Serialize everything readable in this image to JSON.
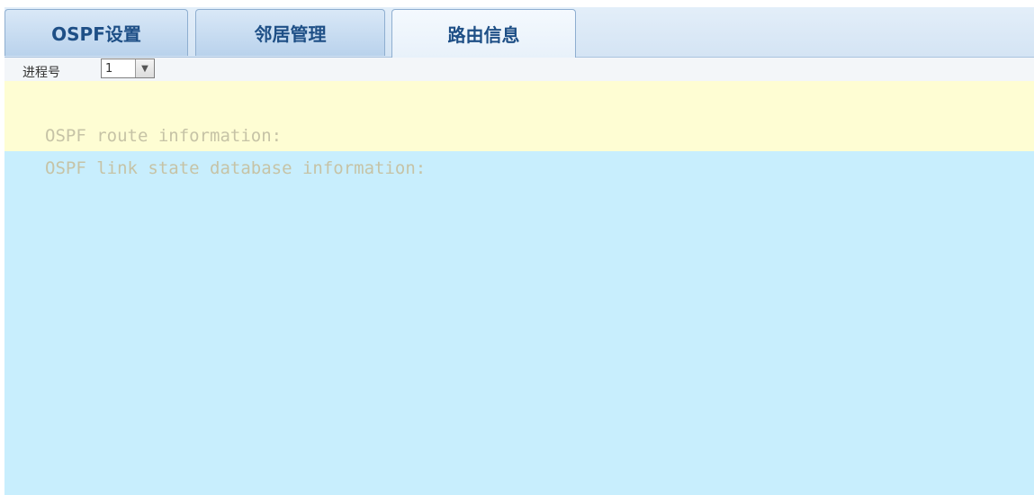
{
  "tabs": [
    {
      "label": "OSPF设置",
      "active": false
    },
    {
      "label": "邻居管理",
      "active": false
    },
    {
      "label": "路由信息",
      "active": true
    }
  ],
  "toolbar": {
    "process_label": "进程号",
    "process_value": "1"
  },
  "info": {
    "lines": [
      "OSPF route information:",
      "OSPF link state database information:"
    ]
  },
  "colors": {
    "tab_text": "#1e4f86",
    "info_background": "#c8eefd",
    "info_highlight": "#fefdd3",
    "info_text": "#c6c3a6"
  }
}
